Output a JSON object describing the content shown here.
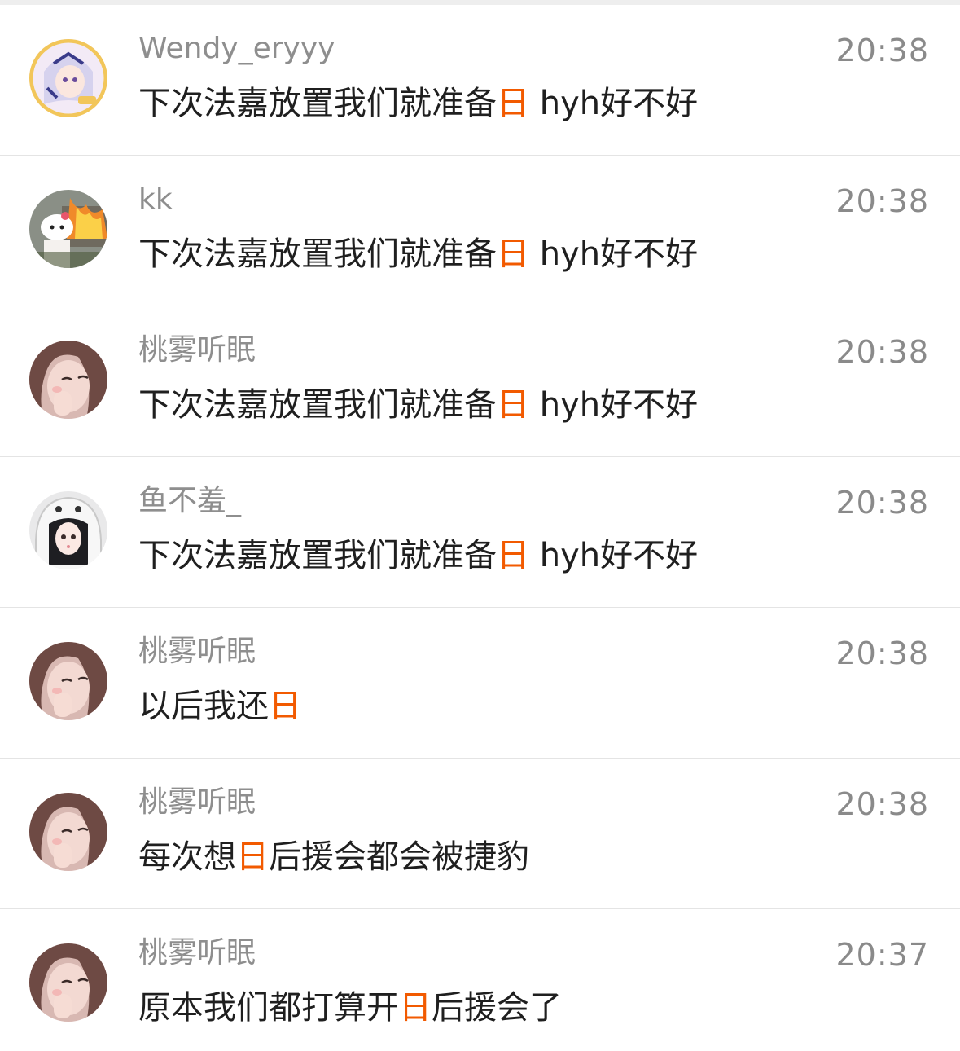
{
  "accent_color": "#f25a00",
  "messages": [
    {
      "avatar_icon": "anime-girl-avatar-icon",
      "name": "Wendy_eryyy",
      "time": "20:38",
      "text_before": "下次法嘉放置我们就准备",
      "highlight": "日",
      "text_after": " hyh好不好"
    },
    {
      "avatar_icon": "hello-kitty-fire-avatar-icon",
      "name": "kk",
      "time": "20:38",
      "text_before": "下次法嘉放置我们就准备",
      "highlight": "日",
      "text_after": " hyh好不好"
    },
    {
      "avatar_icon": "girl-selfie-avatar-icon",
      "name": "桃雾听眠",
      "time": "20:38",
      "text_before": "下次法嘉放置我们就准备",
      "highlight": "日",
      "text_after": " hyh好不好"
    },
    {
      "avatar_icon": "anime-girl-hood-avatar-icon",
      "name": "鱼不羞_",
      "time": "20:38",
      "text_before": "下次法嘉放置我们就准备",
      "highlight": "日",
      "text_after": " hyh好不好"
    },
    {
      "avatar_icon": "girl-selfie-avatar-icon",
      "name": "桃雾听眠",
      "time": "20:38",
      "text_before": "以后我还",
      "highlight": "日",
      "text_after": ""
    },
    {
      "avatar_icon": "girl-selfie-avatar-icon",
      "name": "桃雾听眠",
      "time": "20:38",
      "text_before": "每次想",
      "highlight": "日",
      "text_after": "后援会都会被捷豹"
    },
    {
      "avatar_icon": "girl-selfie-avatar-icon",
      "name": "桃雾听眠",
      "time": "20:37",
      "text_before": "原本我们都打算开",
      "highlight": "日",
      "text_after": "后援会了"
    }
  ]
}
